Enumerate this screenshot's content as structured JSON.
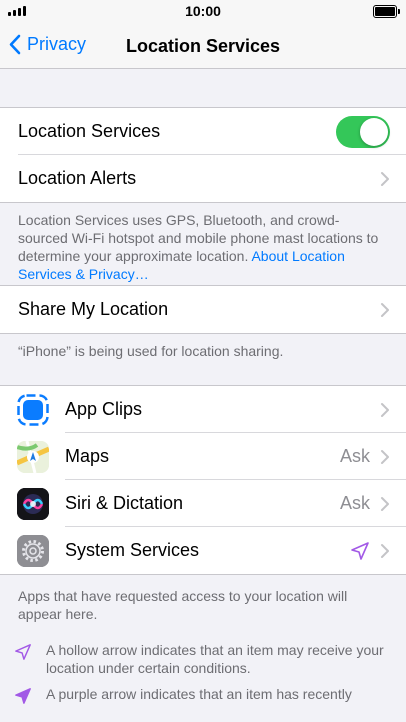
{
  "status_bar": {
    "time": "10:00"
  },
  "nav": {
    "back_label": "Privacy",
    "title": "Location Services"
  },
  "main_group": {
    "location_services_label": "Location Services",
    "location_services_on": true,
    "location_alerts_label": "Location Alerts"
  },
  "location_footnote": {
    "text": "Location Services uses GPS, Bluetooth, and crowd-sourced Wi-Fi hotspot and mobile phone mast locations to determine your approximate location.",
    "link": "About Location Services & Privacy…"
  },
  "share_group": {
    "share_label": "Share My Location"
  },
  "share_footnote": "“iPhone” is being used for location sharing.",
  "apps": [
    {
      "label": "App Clips",
      "value": "",
      "icon": "app-clips-icon"
    },
    {
      "label": "Maps",
      "value": "Ask",
      "icon": "maps-icon"
    },
    {
      "label": "Siri & Dictation",
      "value": "Ask",
      "icon": "siri-icon"
    },
    {
      "label": "System Services",
      "value": "",
      "icon": "settings-gear-icon",
      "status_icon": "location-arrow-purple-hollow"
    }
  ],
  "apps_footnote": "Apps that have requested access to your location will appear here.",
  "legend": [
    {
      "icon": "hollow-arrow-icon",
      "text": "A hollow arrow indicates that an item may receive your location under certain conditions."
    },
    {
      "icon": "purple-arrow-icon",
      "text": "A purple arrow indicates that an item has recently"
    }
  ],
  "colors": {
    "accent": "#007aff",
    "toggle_on": "#34c759",
    "location_purple": "#a259e6"
  }
}
